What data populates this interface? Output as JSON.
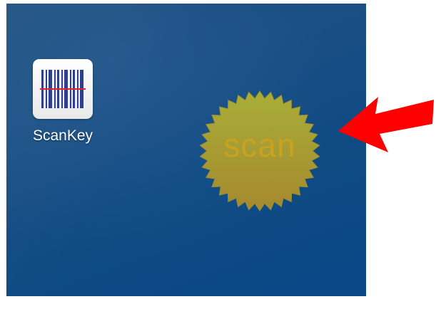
{
  "home_screen": {
    "apps": [
      {
        "label": "ScanKey",
        "icon": "barcode-icon"
      }
    ]
  },
  "scan_widget": {
    "label": "scan",
    "icon": "starburst-badge"
  },
  "annotation": {
    "icon": "red-arrow-pointer"
  },
  "colors": {
    "wallpaper": "#0f4a83",
    "badge_top": "#a9ae38",
    "badge_bottom": "#a5892e",
    "scan_text": "#c8a320",
    "arrow": "#ff0000",
    "barcode": "#2f3f8f",
    "scan_line": "#e0232a"
  }
}
